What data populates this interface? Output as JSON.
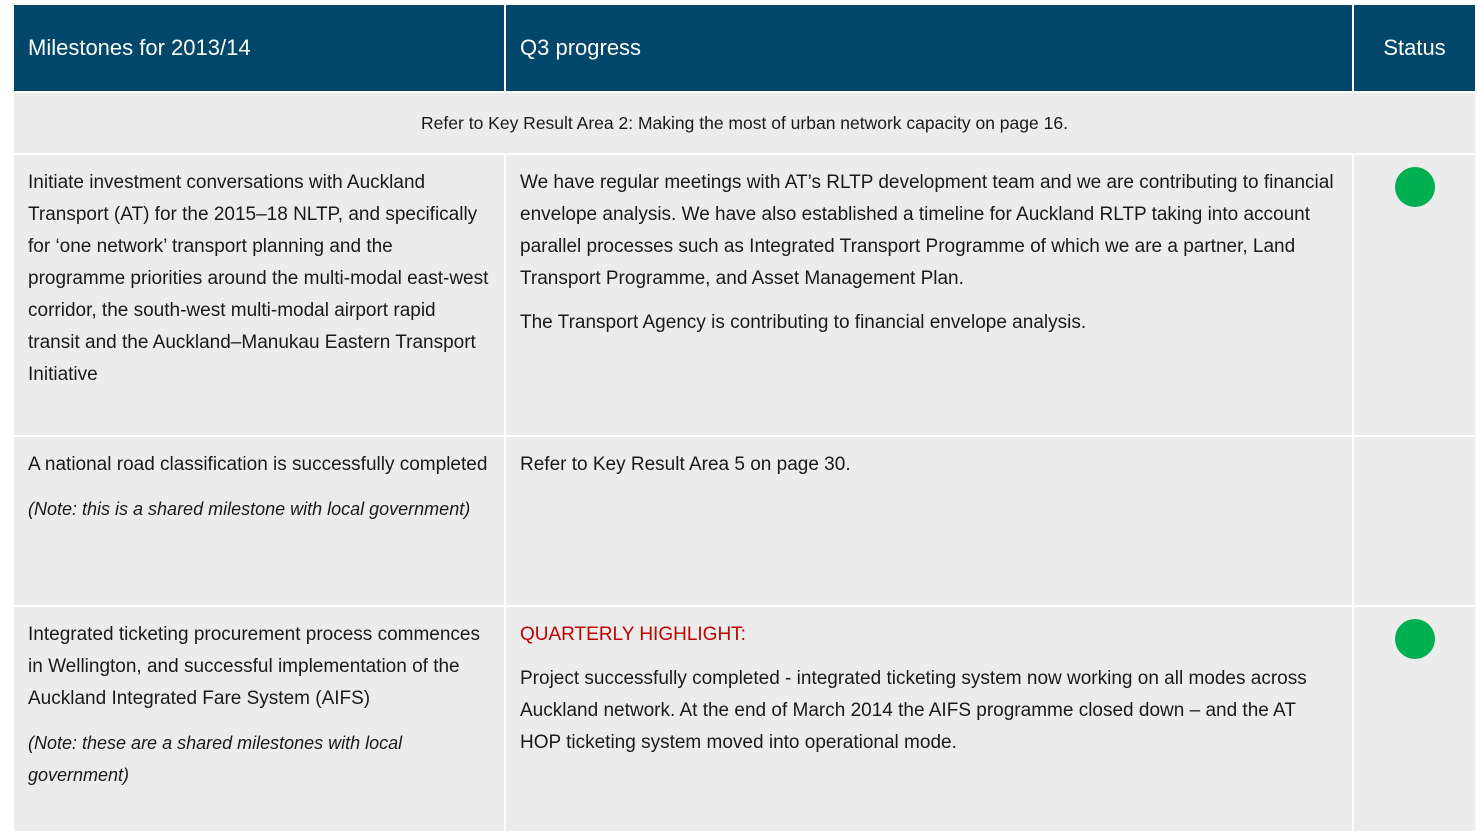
{
  "header": {
    "col1": "Milestones for 2013/14",
    "col2": "Q3 progress",
    "col3": "Status"
  },
  "refer_row": "Refer to Key Result Area 2: Making the most of urban network capacity on page 16.",
  "rows": [
    {
      "milestone": "Initiate investment conversations with Auckland Transport (AT) for the 2015–18 NLTP, and specifically for ‘one network’ transport planning and the programme priorities around the multi-modal east-west corridor, the south-west multi-modal airport rapid transit and the Auckland–Manukau Eastern Transport Initiative",
      "progress_p1": "We have regular meetings with AT’s RLTP development team and we are contributing to financial envelope analysis. We have also established a timeline for Auckland RLTP taking into account parallel processes such as Integrated Transport Programme of which we are a partner, Land Transport Programme, and Asset Management Plan.",
      "progress_p2": "The Transport Agency is contributing to financial envelope analysis.",
      "status_color": "#00b050"
    },
    {
      "milestone": "A national road classification is successfully completed",
      "note": "(Note: this is a shared milestone with local government)",
      "progress_p1": "Refer to Key Result Area 5 on page 30."
    },
    {
      "milestone": "Integrated ticketing procurement process commences in Wellington, and successful implementation of the Auckland Integrated Fare System (AIFS)",
      "note": "(Note: these are a shared milestones with local government)",
      "highlight": "QUARTERLY HIGHLIGHT:",
      "progress_p1": "Project successfully completed - integrated ticketing system now working on all modes across Auckland network. At the end of March 2014 the AIFS programme closed down – and the AT HOP ticketing system moved into operational mode.",
      "status_color": "#00b050"
    }
  ]
}
